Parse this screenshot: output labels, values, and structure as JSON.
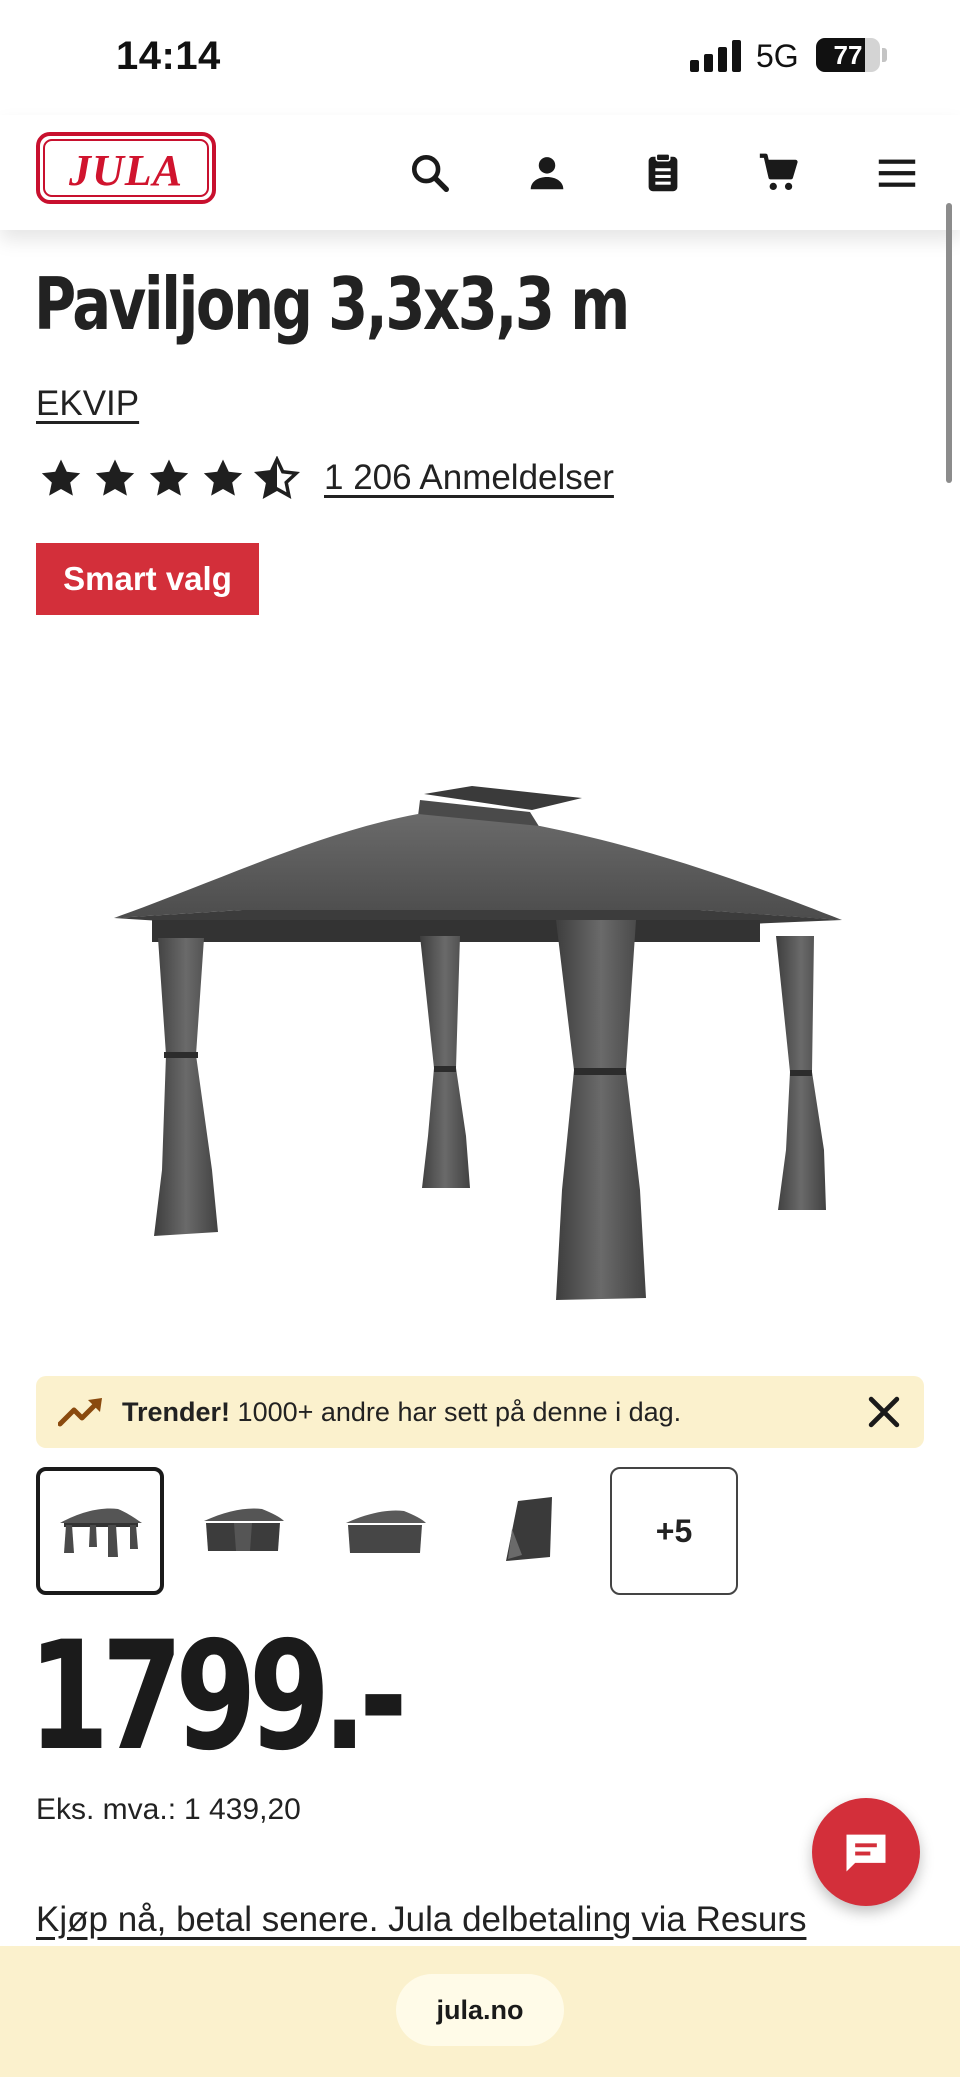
{
  "status_bar": {
    "time": "14:14",
    "network": "5G",
    "battery_percent": 77,
    "battery_label": "77"
  },
  "header": {
    "logo_text": "JULA",
    "icons": [
      "search-icon",
      "account-icon",
      "shopping-list-icon",
      "cart-icon",
      "menu-icon"
    ],
    "brand_color": "#c8102e"
  },
  "product": {
    "title": "Paviljong 3,3x3,3 m",
    "brand": "EKVIP",
    "rating": 4.5,
    "rating_max": 5,
    "reviews_label": "1 206 Anmeldelser",
    "badge": "Smart valg",
    "badge_color": "#d32f3a",
    "image": "gazebo-product-image"
  },
  "trend_banner": {
    "title": "Trender!",
    "text": "1000+ andre har sett på denne i dag."
  },
  "gallery": {
    "thumbnails": [
      "gazebo-front-thumb",
      "gazebo-walls-thumb",
      "gazebo-closed-thumb",
      "side-wall-thumb"
    ],
    "more_label": "+5",
    "active_index": 0
  },
  "price": {
    "amount": "1799.-",
    "ex_vat_label": "Eks. mva.:",
    "ex_vat_value": "1 439,20"
  },
  "payment": {
    "link_text": "Kjøp nå, betal senere. Jula delbetaling via Resurs"
  },
  "browser": {
    "url": "jula.no"
  }
}
